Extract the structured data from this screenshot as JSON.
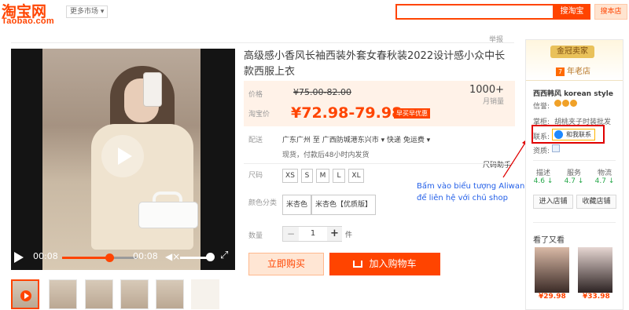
{
  "header": {
    "logo_text": "淘宝网",
    "logo_sub": "Taobao.com",
    "market_label": "更多市场",
    "search_button": "搜淘宝",
    "shop_search_button": "搜本店",
    "report": "举报"
  },
  "product": {
    "title": "高级感小香风长袖西装外套女春秋装2022设计感小众中长款西服上衣",
    "price_label": "价格",
    "old_price": "¥75.00-82.00",
    "promo_label": "淘宝价",
    "new_price": "¥72.98-79.98",
    "promo_tag": "早买早优惠",
    "sales_count": "1000+",
    "sales_label": "月销量",
    "delivery_label": "配送",
    "delivery_text": "广东广州 至  广西防城港东兴市 ▾  快递 免运费 ▾",
    "delivery_note": "现货，付款后48小时内发货",
    "size_helper": "尺码助手",
    "size_label": "尺码",
    "sizes": [
      "XS",
      "S",
      "M",
      "L",
      "XL"
    ],
    "color_label": "颜色分类",
    "colors": [
      "米杏色",
      "米杏色【优质版】"
    ],
    "quantity_label": "数量",
    "quantity_value": "1",
    "quantity_minus": "−",
    "quantity_plus": "+",
    "quantity_unit": "件",
    "buy_now": "立即购买",
    "add_to_cart": "加入购物车"
  },
  "video": {
    "current_time": "00:08",
    "duration": "00:08",
    "progress": 0.62,
    "volume": 0.8
  },
  "annotation": {
    "text": "Bấm vào biểu tượng Aliwangwang để liên hệ với chủ shop"
  },
  "shop": {
    "gold_badge": "金冠卖家",
    "years": "7",
    "years_label": "年老店",
    "name": "西西韩风 korean style",
    "credit_label": "信誉:",
    "keeper_label": "掌柜:",
    "keeper_name": "胡桃夹子时装批发",
    "contact_label": "联系:",
    "contact_button": "和我联系",
    "qualification_label": "资质:",
    "scores": [
      {
        "label": "描述",
        "value": "4.6 ↓"
      },
      {
        "label": "服务",
        "value": "4.7 ↓"
      },
      {
        "label": "物流",
        "value": "4.7 ↓"
      }
    ],
    "enter_shop": "进入店铺",
    "favorite_shop": "收藏店铺",
    "also_viewed": "看了又看",
    "recommended": [
      {
        "price": "¥29.98"
      },
      {
        "price": "¥33.98"
      }
    ]
  },
  "colors": {
    "brand": "#ff4400",
    "annotation": "#2460e8",
    "highlight_box": "#e00000"
  }
}
